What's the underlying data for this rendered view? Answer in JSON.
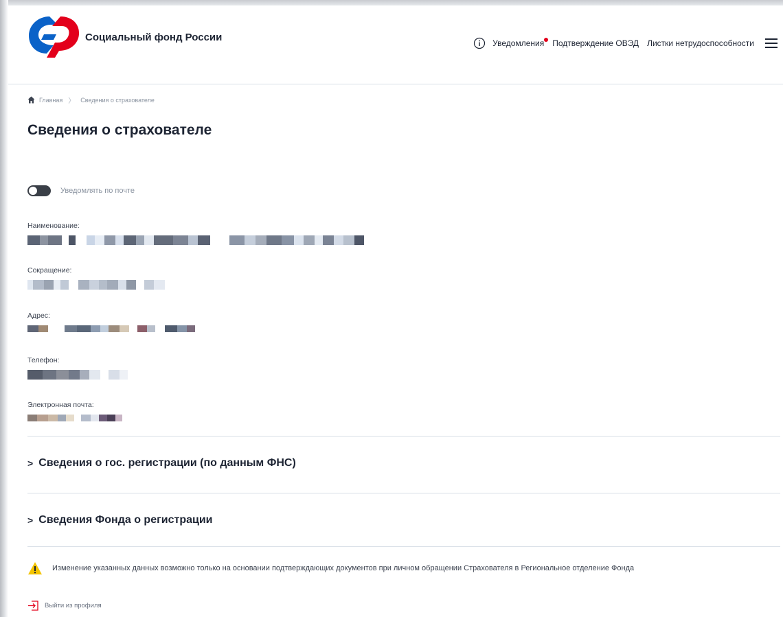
{
  "header": {
    "brand": "Социальный фонд России",
    "nav": [
      {
        "label": "Уведомления",
        "has_dot": true
      },
      {
        "label": "Подтверждение ОВЭД"
      },
      {
        "label": "Листки нетрудоспособности"
      }
    ],
    "info_icon": "info-icon",
    "menu_icon": "hamburger-menu-icon"
  },
  "breadcrumb": {
    "home": "Главная",
    "current": "Сведения о страхователе"
  },
  "page_title": "Сведения о страхователе",
  "notify_toggle": {
    "label": "Уведомлять по почте",
    "enabled": false
  },
  "fields": {
    "name_label": "Наименование:",
    "short_label": "Сокращение:",
    "address_label": "Адрес:",
    "phone_label": "Телефон:",
    "email_label": "Электронная почта:"
  },
  "sections": {
    "fns": "Сведения о гос. регистрации (по данным ФНС)",
    "fund": "Сведения Фонда о регистрации"
  },
  "note": "Изменение указанных данных возможно только на основании подтверждающих документов при личном обращении Страхователя в Региональное отделение Фонда",
  "logout": "Выйти из профиля",
  "colors": {
    "brand_blue": "#0a62c8",
    "brand_red": "#e3001b",
    "warning": "#f4c400",
    "logout_red": "#e3001b"
  }
}
